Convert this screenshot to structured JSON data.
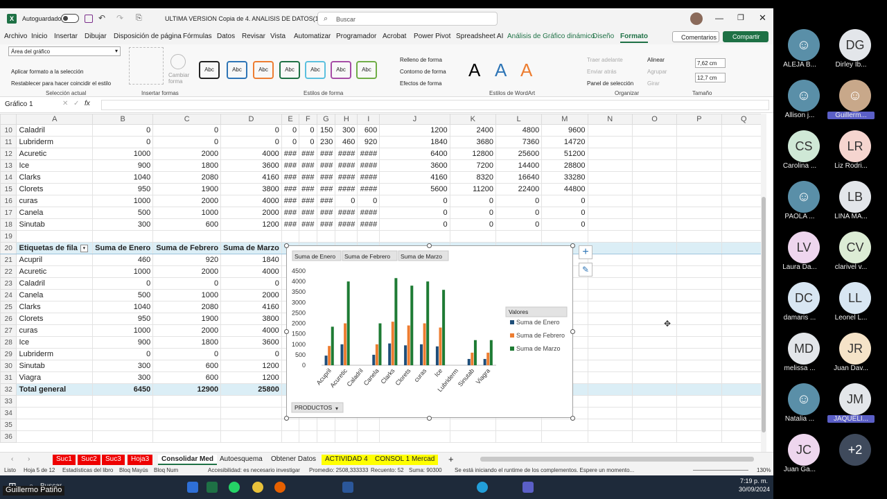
{
  "window": {
    "autosave_label": "Autoguardado",
    "title": "ULTIMA VERSION Copia de 4. ANALISIS DE DATOS(1...",
    "search_placeholder": "Buscar"
  },
  "menu": [
    "Archivo",
    "Inicio",
    "Insertar",
    "Dibujar",
    "Disposición de página",
    "Fórmulas",
    "Datos",
    "Revisar",
    "Vista",
    "Automatizar",
    "Programador",
    "Acrobat",
    "Power Pivot",
    "Spreadsheet AI",
    "Análisis de Gráfico dinámico",
    "Diseño",
    "Formato"
  ],
  "menu_right": {
    "comments": "Comentarios",
    "share": "Compartir"
  },
  "ribbon": {
    "selection_box": "Área del gráfico",
    "apply_format": "Aplicar formato a la selección",
    "reset_style": "Restablecer para hacer coincidir el estilo",
    "group_selection": "Selección actual",
    "change_shape": "Cambiar forma",
    "group_insert_shapes": "Insertar formas",
    "style_sample": "Abc",
    "group_shape_styles": "Estilos de forma",
    "fill": "Relleno de forma",
    "outline": "Contorno de forma",
    "effects": "Efectos de forma",
    "wordart_sample": "A",
    "group_wordart": "Estilos de WordArt",
    "bring_forward": "Traer adelante",
    "send_backward": "Enviar atrás",
    "selection_pane": "Panel de selección",
    "align": "Alinear",
    "group": "Agrupar",
    "rotate": "Girar",
    "group_arrange": "Organizar",
    "height": "7,62 cm",
    "width": "12,7 cm",
    "group_size": "Tamaño"
  },
  "formula_bar": {
    "name_box": "Gráfico 1",
    "fx": "fx"
  },
  "columns": [
    "A",
    "B",
    "C",
    "D",
    "E",
    "F",
    "G",
    "H",
    "I",
    "J",
    "K",
    "L",
    "M",
    "N",
    "O",
    "P",
    "Q"
  ],
  "top_rows": [
    {
      "r": "10",
      "a": "Caladril",
      "b": "0",
      "c": "0",
      "d": "0",
      "e": "0",
      "f": "0",
      "g": "150",
      "h": "300",
      "i": "600",
      "j": "1200",
      "k": "2400",
      "l": "4800",
      "m": "9600"
    },
    {
      "r": "11",
      "a": "Lubriderm",
      "b": "0",
      "c": "0",
      "d": "0",
      "e": "0",
      "f": "0",
      "g": "230",
      "h": "460",
      "i": "920",
      "j": "1840",
      "k": "3680",
      "l": "7360",
      "m": "14720"
    },
    {
      "r": "12",
      "a": "Acuretic",
      "b": "1000",
      "c": "2000",
      "d": "4000",
      "e": "###",
      "f": "###",
      "g": "###",
      "h": "####",
      "i": "####",
      "j": "6400",
      "k": "12800",
      "l": "25600",
      "m": "51200"
    },
    {
      "r": "13",
      "a": "Ice",
      "b": "900",
      "c": "1800",
      "d": "3600",
      "e": "###",
      "f": "###",
      "g": "###",
      "h": "####",
      "i": "####",
      "j": "3600",
      "k": "7200",
      "l": "14400",
      "m": "28800"
    },
    {
      "r": "14",
      "a": "Clarks",
      "b": "1040",
      "c": "2080",
      "d": "4160",
      "e": "###",
      "f": "###",
      "g": "###",
      "h": "####",
      "i": "####",
      "j": "4160",
      "k": "8320",
      "l": "16640",
      "m": "33280"
    },
    {
      "r": "15",
      "a": "Clorets",
      "b": "950",
      "c": "1900",
      "d": "3800",
      "e": "###",
      "f": "###",
      "g": "###",
      "h": "####",
      "i": "####",
      "j": "5600",
      "k": "11200",
      "l": "22400",
      "m": "44800"
    },
    {
      "r": "16",
      "a": "curas",
      "b": "1000",
      "c": "2000",
      "d": "4000",
      "e": "###",
      "f": "###",
      "g": "###",
      "h": "0",
      "i": "0",
      "j": "0",
      "k": "0",
      "l": "0",
      "m": "0"
    },
    {
      "r": "17",
      "a": "Canela",
      "b": "500",
      "c": "1000",
      "d": "2000",
      "e": "###",
      "f": "###",
      "g": "###",
      "h": "####",
      "i": "####",
      "j": "0",
      "k": "0",
      "l": "0",
      "m": "0"
    },
    {
      "r": "18",
      "a": "Sinutab",
      "b": "300",
      "c": "600",
      "d": "1200",
      "e": "###",
      "f": "###",
      "g": "###",
      "h": "####",
      "i": "####",
      "j": "0",
      "k": "0",
      "l": "0",
      "m": "0"
    }
  ],
  "pivot": {
    "headers": [
      "Etiquetas de fila",
      "Suma de Enero",
      "Suma de Febrero",
      "Suma de Marzo"
    ],
    "rows": [
      {
        "r": "21",
        "label": "Acupril",
        "ene": "460",
        "feb": "920",
        "mar": "1840"
      },
      {
        "r": "22",
        "label": "Acuretic",
        "ene": "1000",
        "feb": "2000",
        "mar": "4000"
      },
      {
        "r": "23",
        "label": "Caladril",
        "ene": "0",
        "feb": "0",
        "mar": "0"
      },
      {
        "r": "24",
        "label": "Canela",
        "ene": "500",
        "feb": "1000",
        "mar": "2000"
      },
      {
        "r": "25",
        "label": "Clarks",
        "ene": "1040",
        "feb": "2080",
        "mar": "4160"
      },
      {
        "r": "26",
        "label": "Clorets",
        "ene": "950",
        "feb": "1900",
        "mar": "3800"
      },
      {
        "r": "27",
        "label": "curas",
        "ene": "1000",
        "feb": "2000",
        "mar": "4000"
      },
      {
        "r": "28",
        "label": "Ice",
        "ene": "900",
        "feb": "1800",
        "mar": "3600"
      },
      {
        "r": "29",
        "label": "Lubriderm",
        "ene": "0",
        "feb": "0",
        "mar": "0"
      },
      {
        "r": "30",
        "label": "Sinutab",
        "ene": "300",
        "feb": "600",
        "mar": "1200"
      },
      {
        "r": "31",
        "label": "Viagra",
        "ene": "300",
        "feb": "600",
        "mar": "1200"
      }
    ],
    "total": {
      "r": "32",
      "label": "Total general",
      "ene": "6450",
      "feb": "12900",
      "mar": "25800"
    }
  },
  "empty_rows": [
    "19",
    "33",
    "34",
    "35",
    "36"
  ],
  "chart_data": {
    "type": "bar",
    "field_buttons": [
      "Suma de Enero",
      "Suma de Febrero",
      "Suma de Marzo"
    ],
    "axis_field_button": "PRODUCTOS",
    "legend_title": "Valores",
    "legend_position": "right",
    "categories": [
      "Acupril",
      "Acuretic",
      "Caladril",
      "Canela",
      "Clarks",
      "Clorets",
      "curas",
      "Ice",
      "Lubriderm",
      "Sinutab",
      "Viagra"
    ],
    "series": [
      {
        "name": "Suma de Enero",
        "color": "#1f4e79",
        "values": [
          460,
          1000,
          0,
          500,
          1040,
          950,
          1000,
          900,
          0,
          300,
          300
        ]
      },
      {
        "name": "Suma de Febrero",
        "color": "#ed7d31",
        "values": [
          920,
          2000,
          0,
          1000,
          2080,
          1900,
          2000,
          1800,
          0,
          600,
          600
        ]
      },
      {
        "name": "Suma de Marzo",
        "color": "#1e7b34",
        "values": [
          1840,
          4000,
          0,
          2000,
          4160,
          3800,
          4000,
          3600,
          0,
          1200,
          1200
        ]
      }
    ],
    "yticks": [
      "0",
      "500",
      "1000",
      "1500",
      "2000",
      "2500",
      "3000",
      "3500",
      "4000",
      "4500"
    ],
    "ylim": [
      0,
      4500
    ],
    "grid": false
  },
  "tabs": [
    "Suc1",
    "Suc2",
    "Suc3",
    "Hoja3",
    "Consolidar Med",
    "Autoesquema",
    "Obtener Datos",
    "ACTIVIDAD 4",
    "CONSOL 1 Mercad"
  ],
  "status": {
    "ready": "Listo",
    "sheet": "Hoja 5 de 12",
    "stats": "Estadísticas del libro",
    "caps": "Bloq Mayús",
    "num": "Bloq Num",
    "access": "Accesibilidad: es necesario investigar",
    "avg": "Promedio: 2508,333333",
    "count": "Recuento: 52",
    "sum": "Suma: 90300",
    "addins": "Se está iniciando el runtime de los complementos. Espere un momento...",
    "zoom": "130%"
  },
  "taskbar": {
    "search": "Buscar",
    "time": "7:19 p. m.",
    "date": "30/09/2024",
    "user_tag": "Guillermo Patiño"
  },
  "participants": [
    {
      "initials": "",
      "name": "ALEJA B...",
      "bg": "#5a8fa8"
    },
    {
      "initials": "DG",
      "name": "Dirley Ib...",
      "bg": "#e3e6ea"
    },
    {
      "initials": "",
      "name": "Allison j...",
      "bg": "#5a8fa8"
    },
    {
      "initials": "",
      "name": "Guillerm...",
      "bg": "#c8a88a"
    },
    {
      "initials": "CS",
      "name": "Carolina ...",
      "bg": "#cfe8d6"
    },
    {
      "initials": "LR",
      "name": "Liz Rodri...",
      "bg": "#f5d5cf"
    },
    {
      "initials": "",
      "name": "PAOLA ...",
      "bg": "#5a8fa8"
    },
    {
      "initials": "LB",
      "name": "LINA MA...",
      "bg": "#e3e6ea"
    },
    {
      "initials": "LV",
      "name": "Laura Da...",
      "bg": "#eed6ee"
    },
    {
      "initials": "CV",
      "name": "clarivel v...",
      "bg": "#dcecd5"
    },
    {
      "initials": "DC",
      "name": "damaris ...",
      "bg": "#d8e6f2"
    },
    {
      "initials": "LL",
      "name": "Leonel L...",
      "bg": "#d8e6f2"
    },
    {
      "initials": "MD",
      "name": "melissa ...",
      "bg": "#e3e6ea"
    },
    {
      "initials": "JR",
      "name": "Juan Dav...",
      "bg": "#f5e3c8"
    },
    {
      "initials": "",
      "name": "Natalia ...",
      "bg": "#5a8fa8"
    },
    {
      "initials": "JM",
      "name": "JAQUELI...",
      "bg": "#e3e6ea"
    },
    {
      "initials": "JC",
      "name": "Juan Ga...",
      "bg": "#eed6ee"
    },
    {
      "initials": "+2",
      "name": "",
      "bg": "#3f4a5c"
    }
  ]
}
